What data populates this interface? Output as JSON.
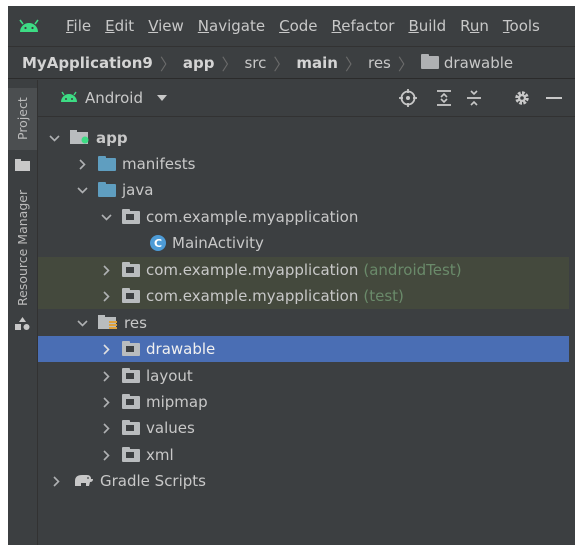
{
  "menu": {
    "items": [
      {
        "pre": "",
        "mn": "F",
        "post": "ile"
      },
      {
        "pre": "",
        "mn": "E",
        "post": "dit"
      },
      {
        "pre": "",
        "mn": "V",
        "post": "iew"
      },
      {
        "pre": "",
        "mn": "N",
        "post": "avigate"
      },
      {
        "pre": "",
        "mn": "C",
        "post": "ode"
      },
      {
        "pre": "",
        "mn": "R",
        "post": "efactor"
      },
      {
        "pre": "",
        "mn": "B",
        "post": "uild"
      },
      {
        "pre": "R",
        "mn": "u",
        "post": "n"
      },
      {
        "pre": "",
        "mn": "T",
        "post": "ools"
      }
    ]
  },
  "breadcrumb": {
    "project": "MyApplication9",
    "module": "app",
    "src": "src",
    "main": "main",
    "res": "res",
    "drawable": "drawable",
    "separator": "〉"
  },
  "toolstrip": {
    "project_tab": "Project",
    "resource_manager_tab": "Resource Manager"
  },
  "panel": {
    "view_mode": "Android"
  },
  "tree": {
    "app": "app",
    "manifests": "manifests",
    "java": "java",
    "pkg_main": "com.example.myapplication",
    "main_activity": "MainActivity",
    "pkg_android_test": "com.example.myapplication",
    "android_test_suffix": "(androidTest)",
    "pkg_test": "com.example.myapplication",
    "test_suffix": "(test)",
    "res": "res",
    "drawable": "drawable",
    "layout": "layout",
    "mipmap": "mipmap",
    "values": "values",
    "xml": "xml",
    "gradle_scripts": "Gradle Scripts"
  },
  "colors": {
    "background": "#3c3f41",
    "selection": "#4a6eb4",
    "test_row": "#44493d",
    "android_green": "#3ddc84",
    "folder_blue": "#5f9ec0",
    "class_icon": "#4d9bd6"
  }
}
